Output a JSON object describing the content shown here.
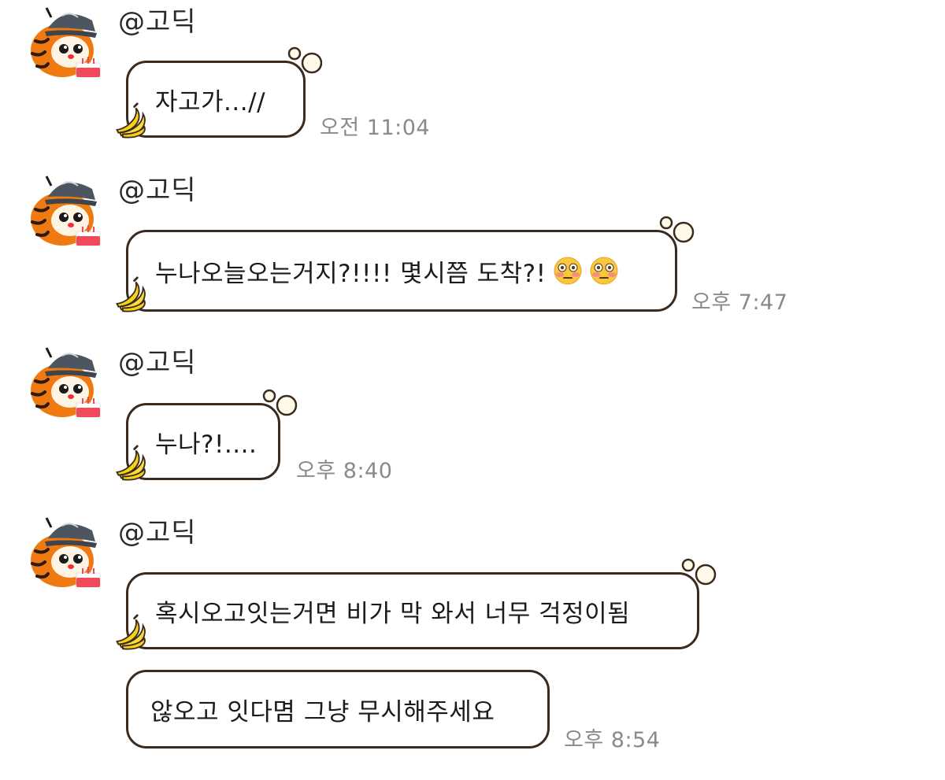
{
  "messages": [
    {
      "sender": "@고딕",
      "text": "자고가...//",
      "time": "오전 11:04"
    },
    {
      "sender": "@고딕",
      "text": "누나오늘오는거지?!!!! 몇시쯤 도착?!",
      "emoji": [
        "flushed-face-icon",
        "flushed-face-icon"
      ],
      "time": "오후 7:47"
    },
    {
      "sender": "@고딕",
      "text": "누나?!....",
      "time": "오후 8:40"
    },
    {
      "sender": "@고딕",
      "text": "혹시오고잇는거면 비가 막 와서 너무 걱정이됨",
      "followup_text": "않오고 잇다몀 그냥 무시해주세요",
      "time": "오후 8:54"
    }
  ],
  "colors": {
    "bubble_border": "#3b2a1e",
    "timestamp": "#8a8a8a",
    "tiger_orange": "#f07a12",
    "banana_yellow": "#f7d21a"
  }
}
